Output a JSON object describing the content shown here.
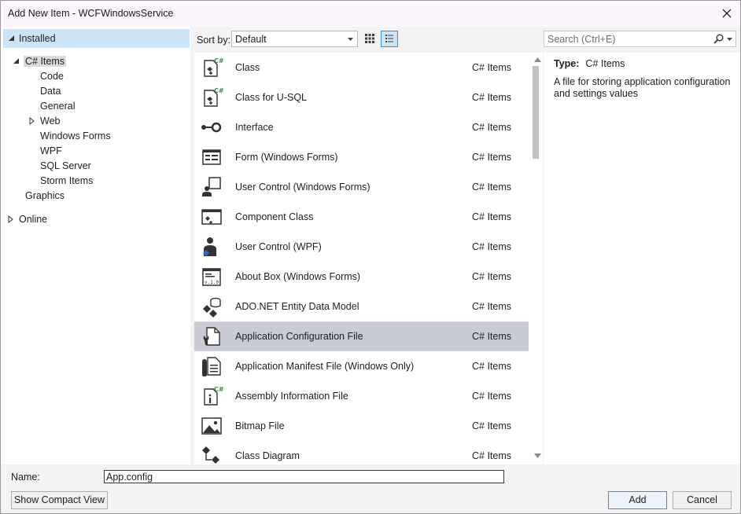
{
  "window": {
    "title": "Add New Item - WCFWindowsService"
  },
  "tree": {
    "installed": "Installed",
    "csharp_items": "C# Items",
    "children": [
      "Code",
      "Data",
      "General",
      "Web",
      "Windows Forms",
      "WPF",
      "SQL Server",
      "Storm Items"
    ],
    "graphics": "Graphics",
    "online": "Online"
  },
  "toolbar": {
    "sort_label": "Sort by:",
    "sort_value": "Default",
    "search_placeholder": "Search (Ctrl+E)"
  },
  "templates": [
    {
      "name": "Class",
      "category": "C# Items",
      "icon": "class-icon"
    },
    {
      "name": "Class for U-SQL",
      "category": "C# Items",
      "icon": "usql-class-icon"
    },
    {
      "name": "Interface",
      "category": "C# Items",
      "icon": "interface-icon"
    },
    {
      "name": "Form (Windows Forms)",
      "category": "C# Items",
      "icon": "form-icon"
    },
    {
      "name": "User Control (Windows Forms)",
      "category": "C# Items",
      "icon": "user-control-icon"
    },
    {
      "name": "Component Class",
      "category": "C# Items",
      "icon": "component-class-icon"
    },
    {
      "name": "User Control (WPF)",
      "category": "C# Items",
      "icon": "wpf-user-control-icon"
    },
    {
      "name": "About Box (Windows Forms)",
      "category": "C# Items",
      "icon": "about-box-icon"
    },
    {
      "name": "ADO.NET Entity Data Model",
      "category": "C# Items",
      "icon": "entity-data-model-icon"
    },
    {
      "name": "Application Configuration File",
      "category": "C# Items",
      "icon": "config-file-icon",
      "selected": true
    },
    {
      "name": "Application Manifest File (Windows Only)",
      "category": "C# Items",
      "icon": "manifest-file-icon"
    },
    {
      "name": "Assembly Information File",
      "category": "C# Items",
      "icon": "assembly-info-icon"
    },
    {
      "name": "Bitmap File",
      "category": "C# Items",
      "icon": "bitmap-file-icon"
    },
    {
      "name": "Class Diagram",
      "category": "C# Items",
      "icon": "class-diagram-icon"
    }
  ],
  "details": {
    "type_label": "Type:",
    "type_value": "C# Items",
    "description": "A file for storing application configuration and settings values"
  },
  "footer": {
    "name_label": "Name:",
    "name_value": "App.config",
    "compact_view_label": "Show Compact View",
    "add_label": "Add",
    "cancel_label": "Cancel"
  },
  "colors": {
    "selection": "#cce4f7",
    "selected_row": "#c9cbd6",
    "accent": "#3d8ddb"
  }
}
